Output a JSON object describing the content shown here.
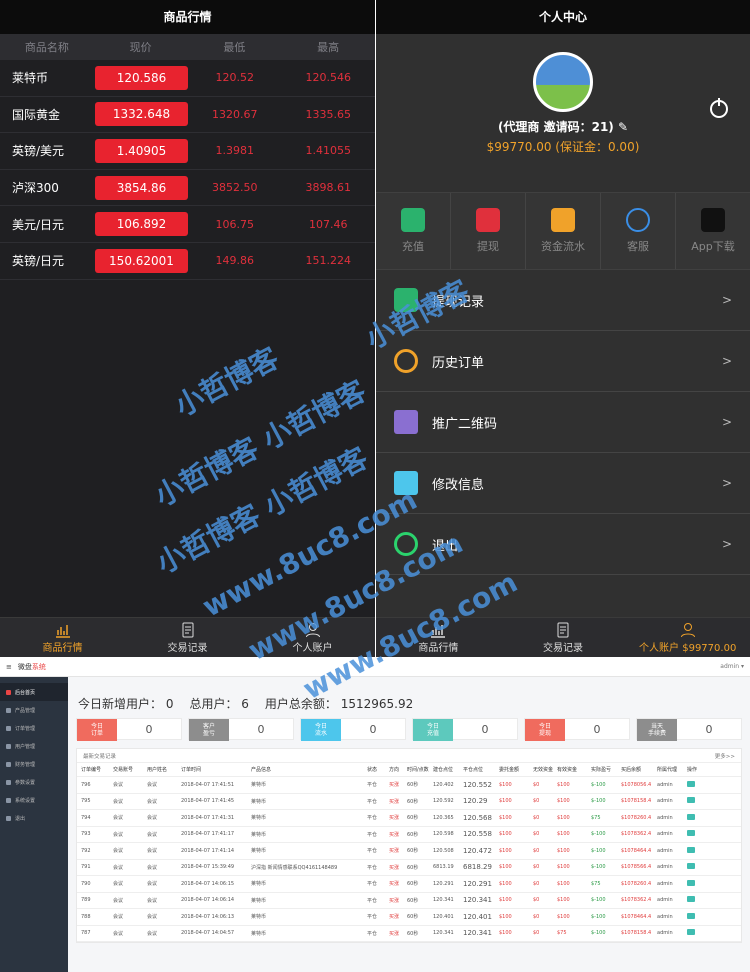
{
  "market": {
    "title": "商品行情",
    "columns": [
      "商品名称",
      "现价",
      "最低",
      "最高"
    ],
    "rows": [
      {
        "name": "莱特币",
        "now": "120.586",
        "low": "120.52",
        "high": "120.546"
      },
      {
        "name": "国际黄金",
        "now": "1332.648",
        "low": "1320.67",
        "high": "1335.65"
      },
      {
        "name": "英镑/美元",
        "now": "1.40905",
        "low": "1.3981",
        "high": "1.41055"
      },
      {
        "name": "泸深300",
        "now": "3854.86",
        "low": "3852.50",
        "high": "3898.61"
      },
      {
        "name": "美元/日元",
        "now": "106.892",
        "low": "106.75",
        "high": "107.46"
      },
      {
        "name": "英镑/日元",
        "now": "150.62001",
        "low": "149.86",
        "high": "151.224"
      }
    ],
    "tabs": [
      "商品行情",
      "交易记录",
      "个人账户"
    ]
  },
  "profile": {
    "title": "个人中心",
    "name_line": "(代理商 邀请码：21)",
    "balance_line": "$99770.00 (保证金：0.00)",
    "quick": [
      "充值",
      "提现",
      "资金流水",
      "客服",
      "App下载"
    ],
    "menu": [
      "提现记录",
      "历史订单",
      "推广二维码",
      "修改信息",
      "退出"
    ],
    "tabs": [
      "商品行情",
      "交易记录",
      "个人账户 $99770.00"
    ]
  },
  "admin": {
    "logo_a": "微盘",
    "logo_b": "系统",
    "user": "admin ▾",
    "sidebar": [
      "后台首页",
      "产品管理",
      "订单管理",
      "用户管理",
      "财务管理",
      "参数设置",
      "系统设置",
      "退出"
    ],
    "stats": {
      "new_users": "今日新增用户： 0",
      "total_users": "总用户： 6",
      "total_balance": "用户总余额： 1512965.92"
    },
    "cards": [
      {
        "label": "今日\n订单",
        "value": "0",
        "color": "#f06b5e"
      },
      {
        "label": "客户\n盈亏",
        "value": "0",
        "color": "#8d8d8d"
      },
      {
        "label": "今日\n流水",
        "value": "0",
        "color": "#4dc6ec"
      },
      {
        "label": "今日\n充值",
        "value": "0",
        "color": "#5dc9bd"
      },
      {
        "label": "今日\n提现",
        "value": "0",
        "color": "#f06b5e"
      },
      {
        "label": "当天\n手续费",
        "value": "0",
        "color": "#8d8d8d"
      }
    ],
    "table": {
      "caption": "最新交易记录",
      "more": "更多>>",
      "headers": [
        "订单编号",
        "交易账号",
        "用户姓名",
        "订单时间",
        "产品信息",
        "状态",
        "方向",
        "时间/点数",
        "建仓点位",
        "平仓点位",
        "委托金额",
        "无效资金",
        "有效资金",
        "实际盈亏",
        "买后余额",
        "所属代理",
        "操作"
      ],
      "rows": [
        [
          "796",
          "会议",
          "会议",
          "2018-04-07 17:41:51",
          "莱特币",
          "平仓",
          "买涨",
          "60秒",
          "120.402",
          "120.552",
          "$100",
          "$0",
          "$100",
          "$-100",
          "$1078056.4",
          "admin",
          ""
        ],
        [
          "795",
          "会议",
          "会议",
          "2018-04-07 17:41:45",
          "莱特币",
          "平仓",
          "买涨",
          "60秒",
          "120.592",
          "120.29",
          "$100",
          "$0",
          "$100",
          "$-100",
          "$1078158.4",
          "admin",
          ""
        ],
        [
          "794",
          "会议",
          "会议",
          "2018-04-07 17:41:31",
          "莱特币",
          "平仓",
          "买涨",
          "60秒",
          "120.365",
          "120.568",
          "$100",
          "$0",
          "$100",
          "$75",
          "$1078260.4",
          "admin",
          ""
        ],
        [
          "793",
          "会议",
          "会议",
          "2018-04-07 17:41:17",
          "莱特币",
          "平仓",
          "买涨",
          "60秒",
          "120.598",
          "120.558",
          "$100",
          "$0",
          "$100",
          "$-100",
          "$1078362.4",
          "admin",
          ""
        ],
        [
          "792",
          "会议",
          "会议",
          "2018-04-07 17:41:14",
          "莱特币",
          "平仓",
          "买涨",
          "60秒",
          "120.508",
          "120.472",
          "$100",
          "$0",
          "$100",
          "$-100",
          "$1078464.4",
          "admin",
          ""
        ],
        [
          "791",
          "会议",
          "会议",
          "2018-04-07 15:39:49",
          "沪深指 新闻情感联系QQ4161148489",
          "平仓",
          "买涨",
          "60秒",
          "6813.19",
          "6818.29",
          "$100",
          "$0",
          "$100",
          "$-100",
          "$1078566.4",
          "admin",
          ""
        ],
        [
          "790",
          "会议",
          "会议",
          "2018-04-07 14:06:15",
          "莱特币",
          "平仓",
          "买涨",
          "60秒",
          "120.291",
          "120.291",
          "$100",
          "$0",
          "$100",
          "$75",
          "$1078260.4",
          "admin",
          ""
        ],
        [
          "789",
          "会议",
          "会议",
          "2018-04-07 14:06:14",
          "莱特币",
          "平仓",
          "买涨",
          "60秒",
          "120.341",
          "120.341",
          "$100",
          "$0",
          "$100",
          "$-100",
          "$1078362.4",
          "admin",
          ""
        ],
        [
          "788",
          "会议",
          "会议",
          "2018-04-07 14:06:13",
          "莱特币",
          "平仓",
          "买涨",
          "60秒",
          "120.401",
          "120.401",
          "$100",
          "$0",
          "$100",
          "$-100",
          "$1078464.4",
          "admin",
          ""
        ],
        [
          "787",
          "会议",
          "会议",
          "2018-04-07 14:04:57",
          "莱特币",
          "平仓",
          "买涨",
          "60秒",
          "120.341",
          "120.341",
          "$100",
          "$0",
          "$75",
          "$-100",
          "$1078158.4",
          "admin",
          ""
        ]
      ]
    }
  },
  "watermark": [
    "小哲博客",
    "小哲博客 小哲博客",
    "小哲博客 小哲博客",
    "www.8uc8.com",
    "www.8uc8.com",
    "www.8uc8.com",
    "小哲博客"
  ],
  "colors": {
    "up": "#e8232f",
    "accent": "#f0a22a",
    "green": "#2a9a45",
    "teal": "#3fbdb1"
  }
}
